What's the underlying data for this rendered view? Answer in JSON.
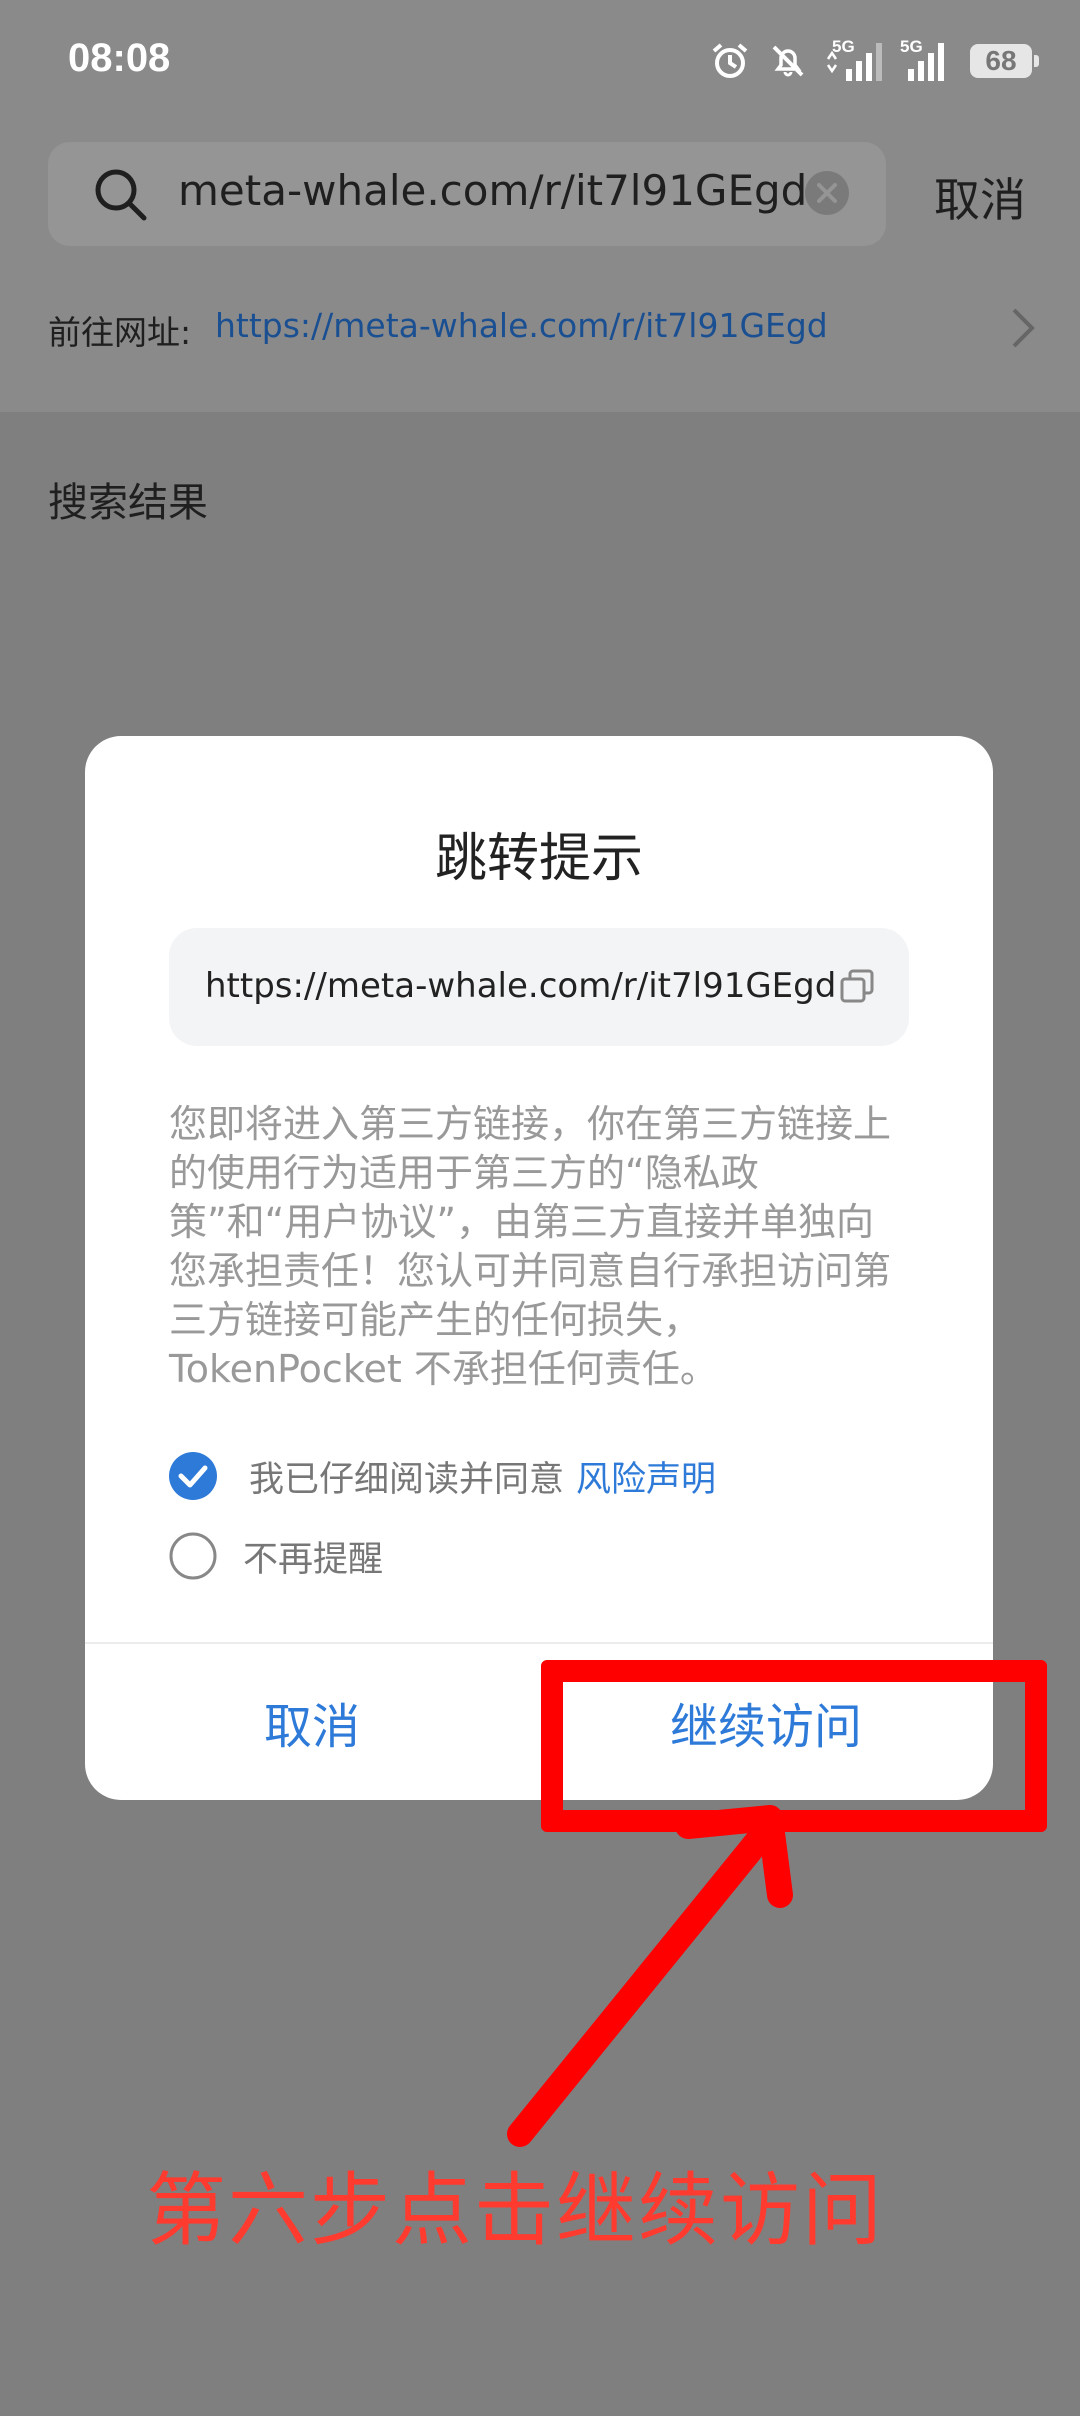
{
  "status_bar": {
    "time": "08:08",
    "signal_1": "5G",
    "signal_2": "5G",
    "battery": "68"
  },
  "search": {
    "query": "meta-whale.com/r/it7l91GEgd",
    "cancel_label": "取消"
  },
  "goto": {
    "label": "前往网址:",
    "url": "https://meta-whale.com/r/it7l91GEgd"
  },
  "results_title": "搜索结果",
  "dialog": {
    "title": "跳转提示",
    "url": "https://meta-whale.com/r/it7l91GEgd",
    "notice": "您即将进入第三方链接，你在第三方链接上的使用行为适用于第三方的“隐私政策”和“用户协议”，由第三方直接并单独向您承担责任！您认可并同意自行承担访问第三方链接可能产生的任何损失，TokenPocket 不承担任何责任。",
    "agree_label": "我已仔细阅读并同意",
    "agree_checked": true,
    "risk_link": "风险声明",
    "remind_label": "不再提醒",
    "remind_checked": false,
    "cancel_button": "取消",
    "continue_button": "继续访问"
  },
  "annotation": {
    "text": "第六步点击继续访问",
    "color": "#ff0000"
  },
  "colors": {
    "accent": "#2e7ad8",
    "link_dark": "#1a4f92",
    "overlay": "#7f7f7f"
  }
}
